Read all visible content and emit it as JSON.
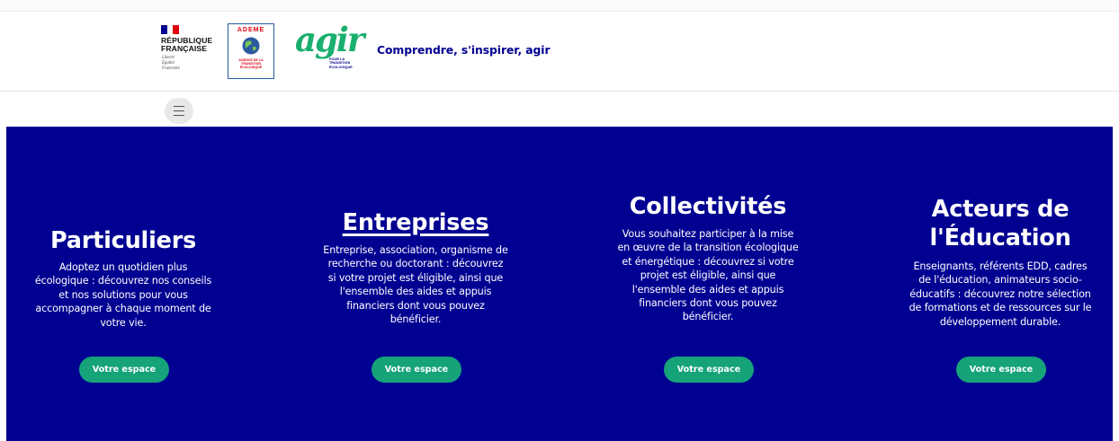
{
  "header": {
    "gov_logo": {
      "title_lines": [
        "RÉPUBLIQUE",
        "FRANÇAISE"
      ],
      "motto_lines": [
        "Liberté",
        "Égalité",
        "Fraternité"
      ],
      "flag_colors": [
        "#000091",
        "#ffffff",
        "#e1000f"
      ]
    },
    "ademe_logo": {
      "name": "ADEME",
      "sub_lines": [
        "AGENCE DE LA",
        "TRANSITION",
        "ÉCOLOGIQUE"
      ]
    },
    "agir_logo": {
      "word": "agir",
      "sub_lines": [
        "POUR LA",
        "TRANSITION",
        "ÉCOLOGIQUE"
      ]
    },
    "tagline": "Comprendre, s'inspirer, agir"
  },
  "nav": {
    "menu_icon": "hamburger-icon"
  },
  "colors": {
    "band": "#000091",
    "cta": "#16a37a",
    "brand_green": "#1aaf6e"
  },
  "audiences": [
    {
      "title_lines": [
        "Particuliers"
      ],
      "desc_lines": [
        "Adoptez un quotidien plus",
        "écologique : découvrez nos conseils",
        "et nos solutions pour vous",
        "accompagner à chaque moment de",
        "votre vie."
      ],
      "cta": "Votre espace"
    },
    {
      "title_lines": [
        "Entreprises"
      ],
      "desc_lines": [
        "Entreprise, association, organisme de",
        "recherche ou doctorant : découvrez",
        "si votre projet est éligible, ainsi que",
        "l'ensemble des aides et appuis",
        "financiers dont vous pouvez",
        "bénéficier."
      ],
      "cta": "Votre espace"
    },
    {
      "title_lines": [
        "Collectivités"
      ],
      "desc_lines": [
        "Vous souhaitez participer à la mise",
        "en œuvre de la transition écologique",
        "et énergétique : découvrez si votre",
        "projet est éligible, ainsi que",
        "l'ensemble des aides et appuis",
        "financiers dont vous pouvez",
        "bénéficier."
      ],
      "cta": "Votre espace"
    },
    {
      "title_lines": [
        "Acteurs de",
        "l'Éducation"
      ],
      "desc_lines": [
        "Enseignants, référents EDD, cadres",
        "de l'éducation, animateurs socio-",
        "éducatifs : découvrez notre sélection",
        "de formations et de ressources sur le",
        "développement durable."
      ],
      "cta": "Votre espace"
    }
  ]
}
